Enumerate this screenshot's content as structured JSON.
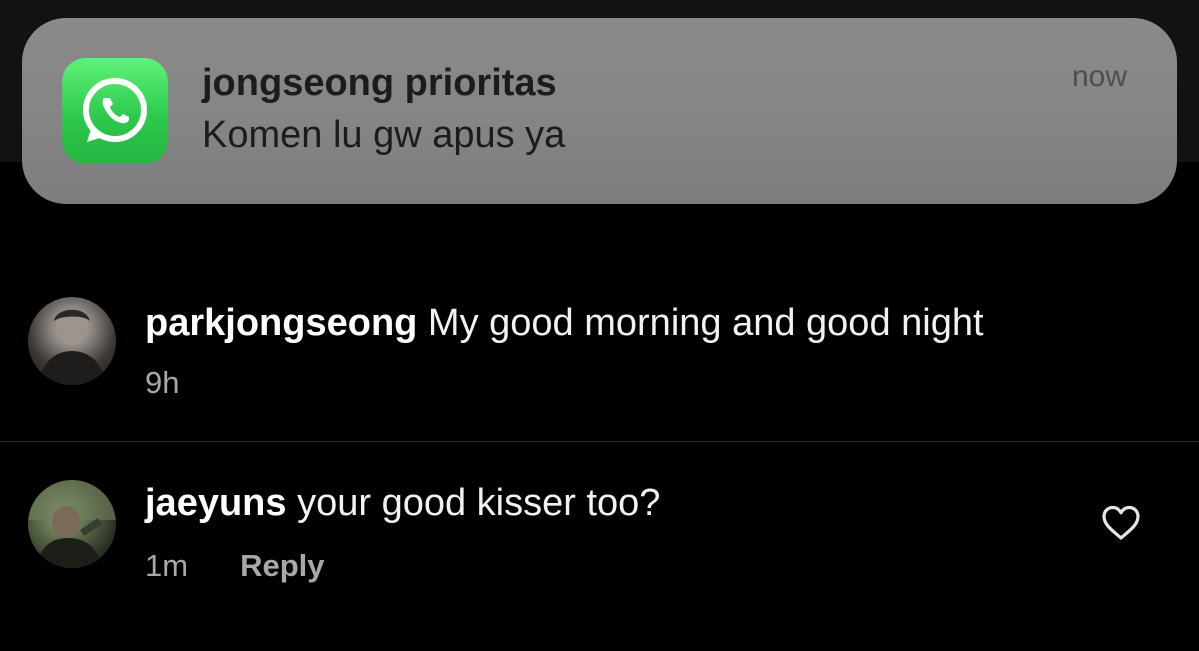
{
  "notification": {
    "app_icon": "whatsapp-icon",
    "title": "jongseong prioritas",
    "message": "Komen lu gw apus ya",
    "time": "now",
    "icon_color": "#2fc94e"
  },
  "comments": [
    {
      "username": "parkjongseong",
      "text": " My good morning and good night",
      "time": "9h",
      "avatar": "profile-photo"
    },
    {
      "username": "jaeyuns",
      "text": " your good kisser too?",
      "time": "1m",
      "reply_label": "Reply",
      "like_icon": "heart-outline-icon",
      "avatar": "profile-photo"
    }
  ]
}
